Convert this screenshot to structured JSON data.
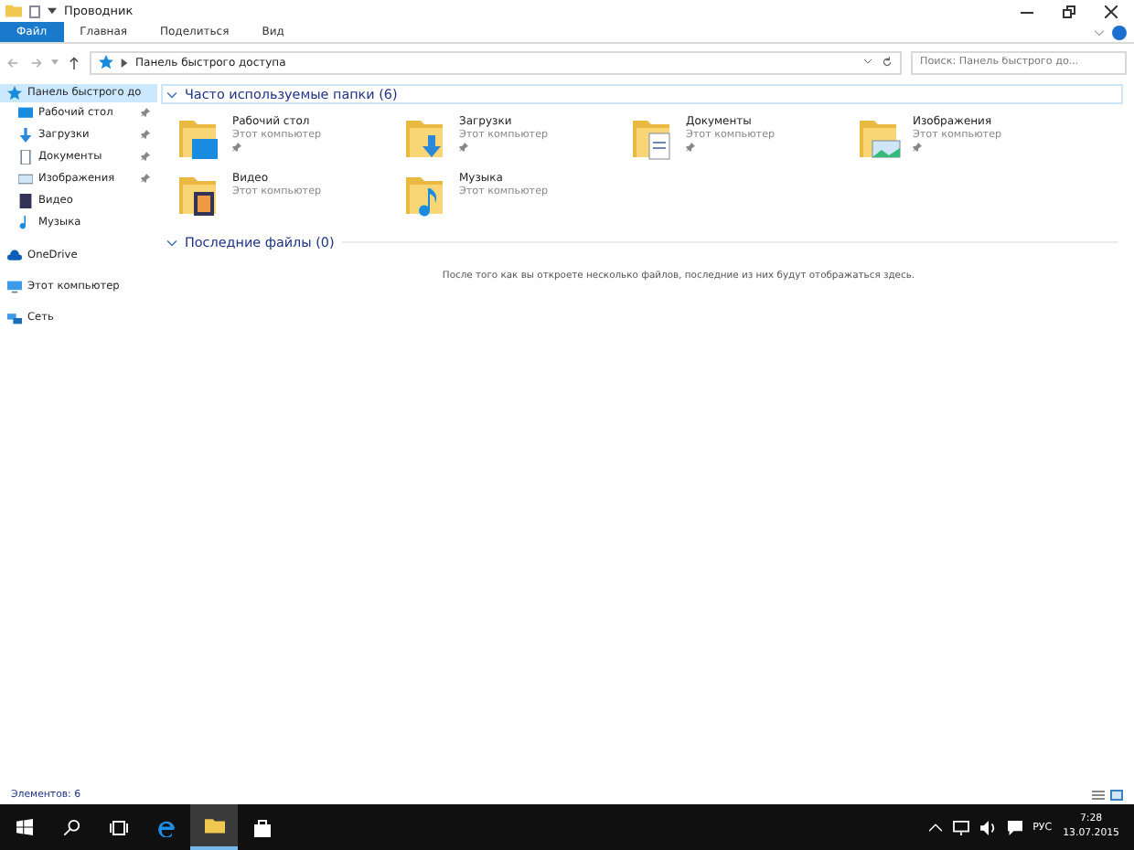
{
  "window": {
    "title": "Проводник"
  },
  "ribbon_tabs": [
    {
      "label": "Файл",
      "selected": false,
      "kind": "file"
    },
    {
      "label": "Главная",
      "selected": false,
      "kind": "tab"
    },
    {
      "label": "Поделиться",
      "selected": false,
      "kind": "tab"
    },
    {
      "label": "Вид",
      "selected": false,
      "kind": "tab"
    }
  ],
  "address": {
    "path": "Панель быстрого доступа",
    "search_placeholder": "Поиск: Панель быстрого до..."
  },
  "sidebar": {
    "items": [
      {
        "label": "Панель быстрого до",
        "kind": "star",
        "selected": true,
        "children": [
          {
            "label": "Рабочий стол",
            "kind": "desktop",
            "pinned": true
          },
          {
            "label": "Загрузки",
            "kind": "downloads",
            "pinned": true
          },
          {
            "label": "Документы",
            "kind": "documents",
            "pinned": true
          },
          {
            "label": "Изображения",
            "kind": "pictures",
            "pinned": true
          },
          {
            "label": "Видео",
            "kind": "video",
            "pinned": false
          },
          {
            "label": "Музыка",
            "kind": "music",
            "pinned": false
          }
        ]
      },
      {
        "label": "OneDrive",
        "kind": "cloud",
        "selected": false
      },
      {
        "label": "Этот компьютер",
        "kind": "pc",
        "selected": false
      },
      {
        "label": "Сеть",
        "kind": "network",
        "selected": false
      }
    ]
  },
  "frequent": {
    "title": "Часто используемые папки (6)",
    "expanded": true,
    "folders": [
      {
        "name": "Рабочий стол",
        "location": "Этот компьютер",
        "kind": "desktop",
        "pinned": true
      },
      {
        "name": "Загрузки",
        "location": "Этот компьютер",
        "kind": "downloads",
        "pinned": true
      },
      {
        "name": "Документы",
        "location": "Этот компьютер",
        "kind": "documents",
        "pinned": true
      },
      {
        "name": "Изображения",
        "location": "Этот компьютер",
        "kind": "pictures",
        "pinned": true
      },
      {
        "name": "Видео",
        "location": "Этот компьютер",
        "kind": "video",
        "pinned": false
      },
      {
        "name": "Музыка",
        "location": "Этот компьютер",
        "kind": "music",
        "pinned": false
      }
    ]
  },
  "recent": {
    "title": "Последние файлы (0)",
    "expanded": true,
    "empty_message": "После того как вы откроете несколько файлов, последние из них будут отображаться здесь."
  },
  "status_bar": {
    "text": "Элементов: 6"
  },
  "taskbar": {
    "language": "РУС",
    "time": "7:28",
    "date": "13.07.2015"
  }
}
